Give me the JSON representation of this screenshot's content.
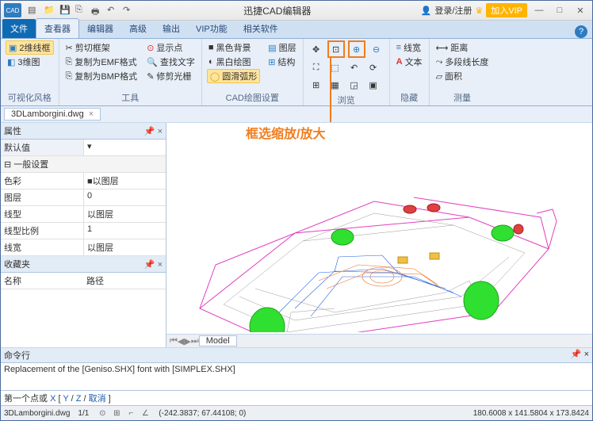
{
  "app": {
    "title": "迅捷CAD编辑器",
    "logo": "CAD"
  },
  "title_right": {
    "login": "登录/注册",
    "vip": "加入VIP"
  },
  "tabs": {
    "file": "文件",
    "viewer": "查看器",
    "editor": "编辑器",
    "advanced": "高级",
    "output": "输出",
    "vipfn": "VIP功能",
    "related": "相关软件"
  },
  "ribbon": {
    "view": {
      "wire2d": "2维线框",
      "view3d": "3维图",
      "label": "可视化风格"
    },
    "tools": {
      "clip": "剪切框架",
      "emf": "复制为EMF格式",
      "bmp": "复制为BMP格式",
      "showpt": "显示点",
      "find": "查找文字",
      "polish": "修剪光栅",
      "label": "工具"
    },
    "cad": {
      "blackbg": "黑色背景",
      "bwdraw": "黑白绘图",
      "smooth": "圆滑弧形",
      "layer": "图层",
      "struct": "结构",
      "label": "CAD绘图设置"
    },
    "browse": {
      "label": "浏览"
    },
    "hide": {
      "line": "线宽",
      "text": "文本",
      "label": "隐藏"
    },
    "measure": {
      "dist": "距离",
      "poly": "多段线长度",
      "area": "面积",
      "label": "测量"
    }
  },
  "annot": "框选缩放/放大",
  "filetab": {
    "name": "3DLamborgini.dwg"
  },
  "props": {
    "title": "属性",
    "default": "默认值",
    "section": "一般设置",
    "rows": {
      "color": {
        "k": "色彩",
        "v": "■以图层"
      },
      "layer": {
        "k": "图层",
        "v": "0"
      },
      "ltype": {
        "k": "线型",
        "v": "以图层"
      },
      "lscale": {
        "k": "线型比例",
        "v": "1"
      },
      "lwidth": {
        "k": "线宽",
        "v": "以图层"
      }
    }
  },
  "fav": {
    "title": "收藏夹",
    "name": "名称",
    "path": "路径"
  },
  "model_tab": "Model",
  "cmd": {
    "title": "命令行",
    "text": "Replacement of the [Geniso.SHX] font with [SIMPLEX.SHX]"
  },
  "prompt": {
    "pre": "第一个点或",
    "x": "X",
    "y": "Y",
    "z": "Z",
    "cancel": "取消"
  },
  "status": {
    "file": "3DLamborgini.dwg",
    "ratio": "1/1",
    "coords": "(-242.3837; 67.44108; 0)",
    "dims": "180.6008 x 141.5804 x 173.8424"
  }
}
